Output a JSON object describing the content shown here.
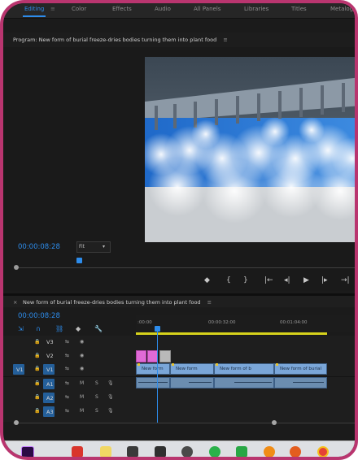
{
  "workspace_tabs": [
    "Editing",
    "Color",
    "Effects",
    "Audio",
    "All Panels",
    "Libraries",
    "Titles",
    "Metalogging"
  ],
  "program_monitor": {
    "title": "Program: New form of burial freeze-dries bodies turning them into plant food",
    "menu_icon": "menu-lines-icon",
    "timecode": "00:00:08:28",
    "fit_label": "Fit",
    "controls": [
      "marker-icon",
      "mark-in-icon",
      "mark-out-icon",
      "go-to-in-icon",
      "step-back-icon",
      "play-icon",
      "step-forward-icon",
      "go-to-out-icon"
    ]
  },
  "timeline": {
    "title": "New form of burial freeze-dries bodies turning them into plant food",
    "timecode": "00:00:08:28",
    "ruler_labels": [
      ":00:00",
      "00:00:32:00",
      "00:01:04:00"
    ],
    "tracks": {
      "video": [
        "V3",
        "V2",
        "V1"
      ],
      "audio": [
        "A1",
        "A2",
        "A3"
      ]
    },
    "source_patch_video": "V1",
    "toggle_labels": {
      "mute": "M",
      "solo": "S"
    },
    "video_clips": [
      "New form",
      "New form",
      "New form of b",
      "New form of burial"
    ]
  },
  "taskbar": {
    "icons": [
      "premiere-icon",
      "folder-red-icon",
      "sticky-notes-icon",
      "calculator-icon",
      "mail-icon",
      "settings-icon",
      "whatsapp-icon",
      "chat-icon",
      "messenger-icon",
      "firefox-icon",
      "chrome-icon"
    ]
  },
  "colors": {
    "accent_blue": "#2d8ceb",
    "frame_pink": "#b9356f",
    "clip_pink": "#e06ad6",
    "work_area_yellow": "#d6d21c"
  }
}
